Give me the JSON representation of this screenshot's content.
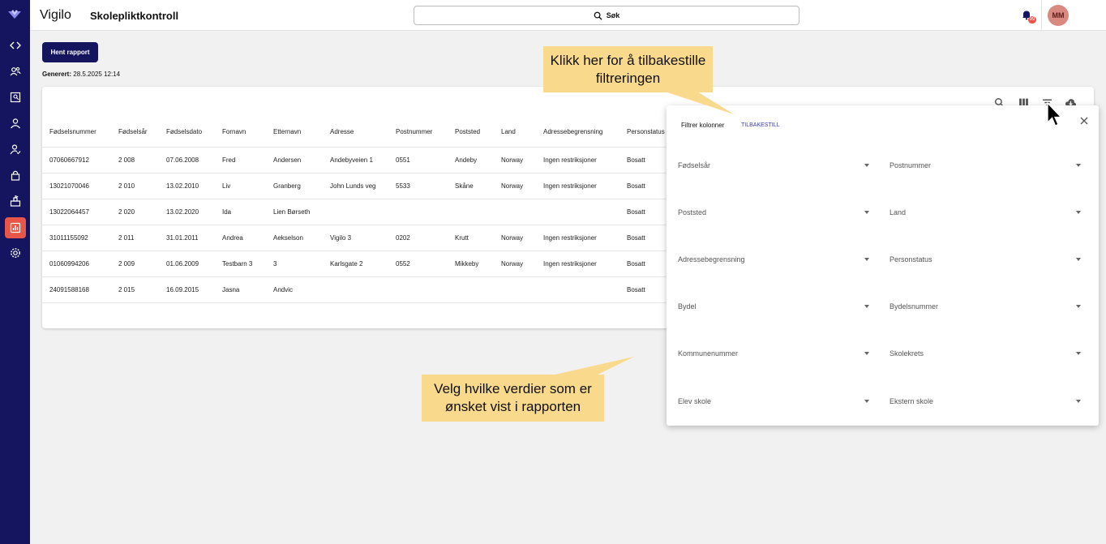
{
  "app": {
    "brand": "Vigilo",
    "title": "Skolepliktkontroll"
  },
  "search": {
    "label": "Søk"
  },
  "notifications": {
    "badge": "99"
  },
  "user": {
    "initials": "MM"
  },
  "colors": {
    "sidebar": "#15155f",
    "accent": "#e8564a",
    "button": "#15155f",
    "callout": "#f9d98c",
    "link": "#3b3bb0"
  },
  "sidebar": {
    "items": [
      {
        "icon": "code-icon"
      },
      {
        "icon": "users-icon"
      },
      {
        "icon": "person-search-icon"
      },
      {
        "icon": "person-icon"
      },
      {
        "icon": "person-check-icon"
      },
      {
        "icon": "lock-icon"
      },
      {
        "icon": "school-icon"
      },
      {
        "icon": "reports-icon",
        "active": true
      },
      {
        "icon": "settings-icon"
      }
    ]
  },
  "report": {
    "fetch_button": "Hent rapport",
    "generated_label": "Generert:",
    "generated_value": "28.5.2025 12:14"
  },
  "toolbar": {
    "icons": [
      "search-icon",
      "columns-icon",
      "filter-icon",
      "download-icon"
    ]
  },
  "table": {
    "columns": [
      "Fødselsnummer",
      "Fødselsår",
      "Fødselsdato",
      "Fornavn",
      "Etternavn",
      "Adresse",
      "Postnummer",
      "Poststed",
      "Land",
      "Adressebegrensning",
      "Personstatus"
    ],
    "rows": [
      [
        "07060667912",
        "2 008",
        "07.06.2008",
        "Fred",
        "Andersen",
        "Andebyveien 1",
        "0551",
        "Andeby",
        "Norway",
        "Ingen restriksjoner",
        "Bosatt"
      ],
      [
        "13021070046",
        "2 010",
        "13.02.2010",
        "Liv",
        "Granberg",
        "John Lunds veg",
        "5533",
        "Skåne",
        "Norway",
        "Ingen restriksjoner",
        "Bosatt"
      ],
      [
        "13022064457",
        "2 020",
        "13.02.2020",
        "Ida",
        "Lien Børseth",
        "",
        "",
        "",
        "",
        "",
        "Bosatt"
      ],
      [
        "31011155092",
        "2 011",
        "31.01.2011",
        "Andrea",
        "Aekselson",
        "Vigilo 3",
        "0202",
        "Krutt",
        "Norway",
        "Ingen restriksjoner",
        "Bosatt"
      ],
      [
        "01060994206",
        "2 009",
        "01.06.2009",
        "Testbarn 3",
        "3",
        "Karlsgate 2",
        "0552",
        "Mikkeby",
        "Norway",
        "Ingen restriksjoner",
        "Bosatt"
      ],
      [
        "24091588168",
        "2 015",
        "16.09.2015",
        "Jasna",
        "Andvic",
        "",
        "",
        "",
        "",
        "",
        "Bosatt"
      ]
    ]
  },
  "filter_panel": {
    "title": "Filtrer kolonner",
    "reset": "TILBAKESTILL",
    "fields": [
      "Fødselsår",
      "Postnummer",
      "Poststed",
      "Land",
      "Adressebegrensning",
      "Personstatus",
      "Bydel",
      "Bydelsnummer",
      "Kommunenummer",
      "Skolekrets",
      "Elev skole",
      "Ekstern skole"
    ]
  },
  "callouts": {
    "reset_hint": "Klikk her for å tilbakestille filtreringen",
    "columns_hint": "Velg hvilke verdier som er ønsket vist i rapporten"
  }
}
